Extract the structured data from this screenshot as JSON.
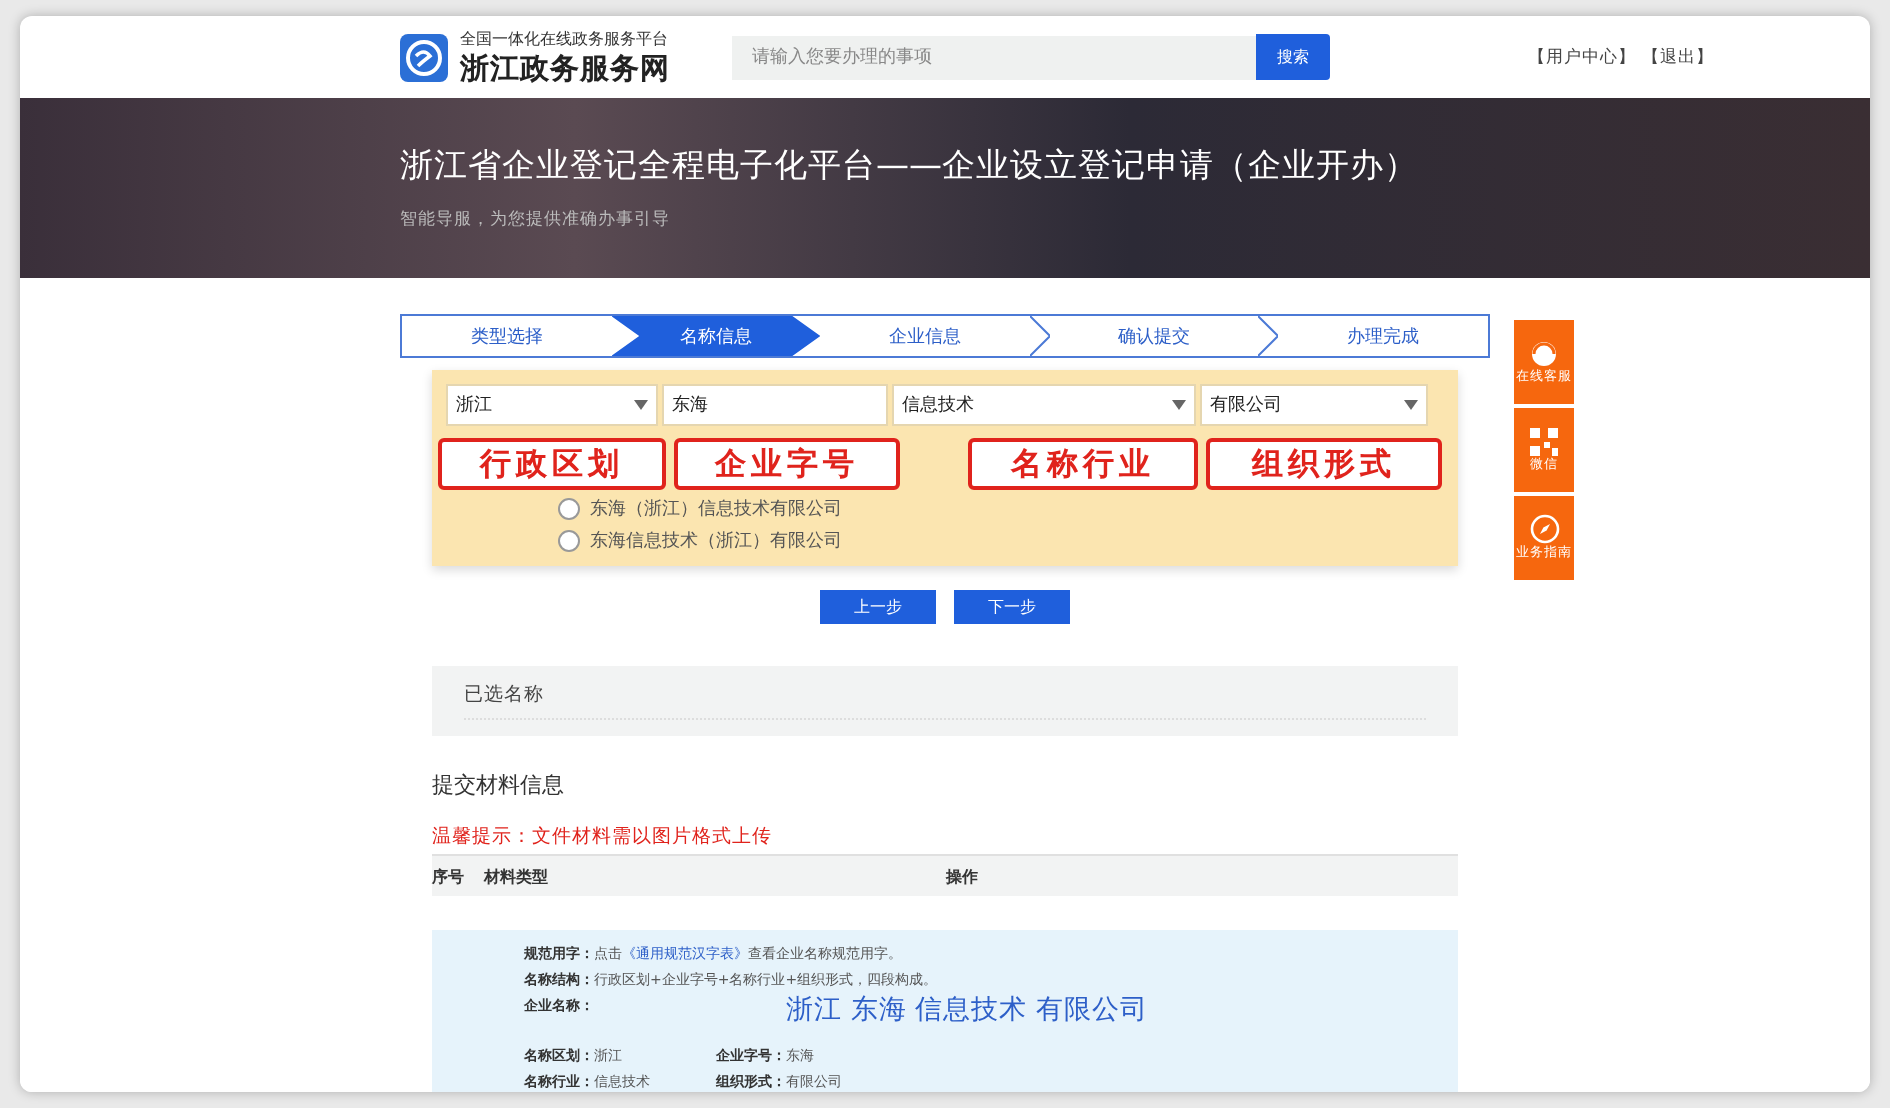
{
  "header": {
    "platform_subtitle": "全国一体化在线政务服务平台",
    "platform_name": "浙江政务服务网",
    "search": {
      "placeholder": "请输入您要办理的事项"
    },
    "search_button": "搜索",
    "user_links": [
      "【用户中心】",
      "【退出】"
    ]
  },
  "banner": {
    "title": "浙江省企业登记全程电子化平台——企业设立登记申请（企业开办）",
    "subtitle": "智能导服，为您提供准确办事引导"
  },
  "steps": [
    {
      "label": "类型选择",
      "selected": false
    },
    {
      "label": "名称信息",
      "selected": true
    },
    {
      "label": "企业信息",
      "selected": false
    },
    {
      "label": "确认提交",
      "selected": false
    },
    {
      "label": "办理完成",
      "selected": false
    }
  ],
  "name_form": {
    "fields": [
      {
        "kind": "select",
        "value": "浙江"
      },
      {
        "kind": "input",
        "value": "东海"
      },
      {
        "kind": "select",
        "value": "信息技术"
      },
      {
        "kind": "select",
        "value": "有限公司"
      }
    ],
    "callouts": [
      "行政区划",
      "企业字号",
      "名称行业",
      "组织形式"
    ],
    "options": [
      {
        "label": "东海（浙江）信息技术有限公司",
        "selected": false
      },
      {
        "label": "东海信息技术（浙江）有限公司",
        "selected": false
      }
    ]
  },
  "buttons": [
    "上一步",
    "下一步"
  ],
  "selected_name": {
    "title": "已选名称"
  },
  "materials": {
    "title": "提交材料信息",
    "hint": "温馨提示：文件材料需以图片格式上传",
    "columns": [
      "序号",
      "材料类型",
      "操作"
    ]
  },
  "name_info": {
    "rules": [
      {
        "label": "规范用字：",
        "before": "点击",
        "link": "《通用规范汉字表》",
        "after": "查看企业名称规范用字。"
      },
      {
        "label": "名称结构：",
        "before": "行政区划+企业字号+名称行业+组织形式，四段构成。"
      }
    ],
    "preview_label": "企业名称：",
    "preview_parts": [
      "浙江",
      "东海",
      "信息技术",
      "有限公司"
    ],
    "details": [
      {
        "label": "名称区划：",
        "value": "浙江"
      },
      {
        "label": "企业字号：",
        "value": "东海"
      },
      {
        "label": "名称行业：",
        "value": "信息技术"
      },
      {
        "label": "组织形式：",
        "value": "有限公司"
      }
    ]
  },
  "side_bar": [
    {
      "kind": "service",
      "label": "在线客服"
    },
    {
      "kind": "qr",
      "label": "微信"
    },
    {
      "kind": "compass",
      "label": "业务指南"
    }
  ]
}
